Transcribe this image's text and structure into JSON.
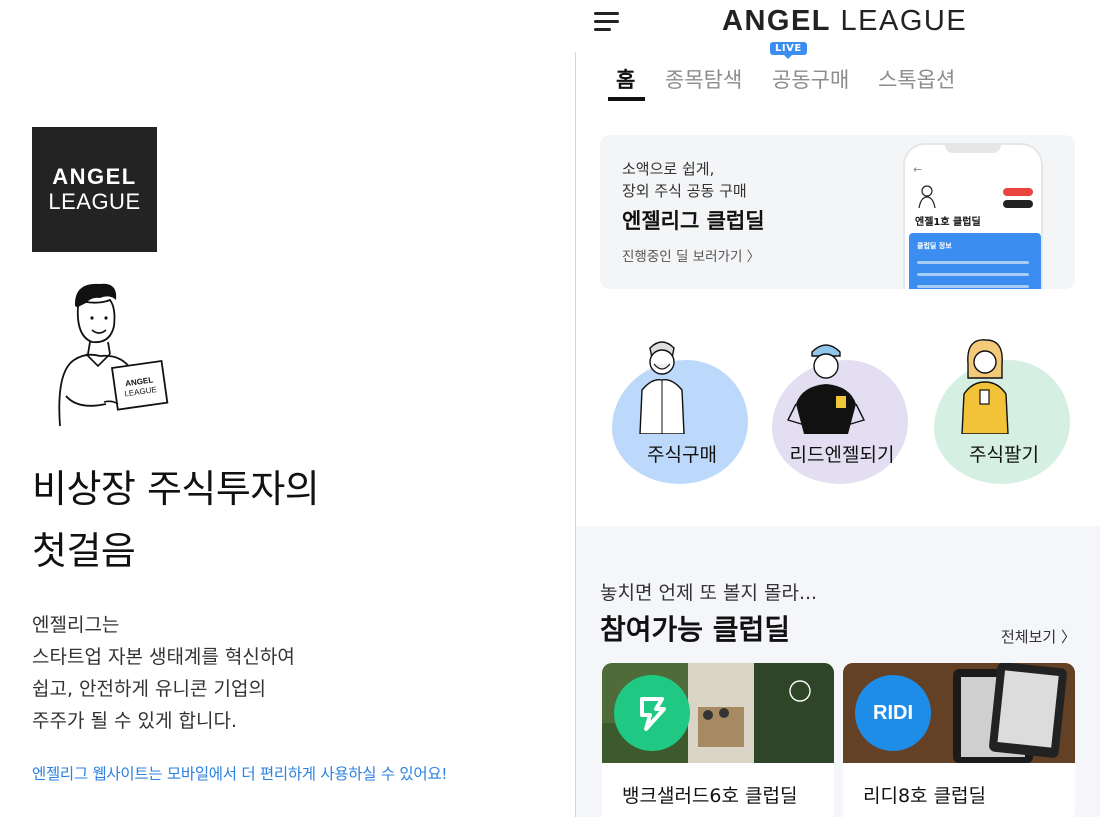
{
  "left_panel": {
    "logo": {
      "line1": "ANGEL",
      "line2": "LEAGUE"
    },
    "illustration_laptop": {
      "line1": "ANGEL",
      "line2": "LEAGUE"
    },
    "headline": {
      "line1": "비상장 주식투자의",
      "line2": "첫걸음"
    },
    "description": [
      "엔젤리그는",
      "스타트업 자본 생태계를 혁신하여",
      "쉽고, 안전하게 유니콘 기업의",
      "주주가 될 수 있게 합니다."
    ],
    "mobile_note": "엔젤리그 웹사이트는 모바일에서 더 편리하게 사용하실 수 있어요!",
    "mobile_note_color": "#2c82e0"
  },
  "header": {
    "brand_bold": "ANGEL",
    "brand_light": " LEAGUE",
    "menu_icon": "hamburger-icon"
  },
  "tabs": {
    "items": [
      "홈",
      "종목탐색",
      "공동구매",
      "스톡옵션"
    ],
    "active_index": 0,
    "live_badge": "LIVE"
  },
  "banner": {
    "subtitle_line1": "소액으로 쉽게,",
    "subtitle_line2": "장외 주식 공동 구매",
    "title": "엔젤리그 클럽딜",
    "cta": "진행중인 딜 보러가기 〉",
    "phone_back": "←",
    "phone_title": "엔젤1호 클럽딜",
    "phone_card_title": "클럽딜 정보"
  },
  "personas": [
    {
      "label": "주식구매",
      "color": "#bcd9fb"
    },
    {
      "label": "리드엔젤되기",
      "color": "#e4def2"
    },
    {
      "label": "주식팔기",
      "color": "#d5f0e3"
    }
  ],
  "clubdeals": {
    "eyebrow": "놓치면 언제 또 볼지 몰라...",
    "heading": "참여가능 클럽딜",
    "see_all": "전체보기 〉",
    "cards": [
      {
        "name": "뱅크샐러드6호 클럽딜",
        "logo_color": "#1fc983"
      },
      {
        "name": "리디8호 클럽딜",
        "logo_text": "RIDI",
        "logo_color": "#1e8de8"
      }
    ]
  },
  "colors": {
    "accent_blue": "#3b8ef0",
    "section_bg": "#f5f6f9",
    "text_dark": "#111111"
  }
}
